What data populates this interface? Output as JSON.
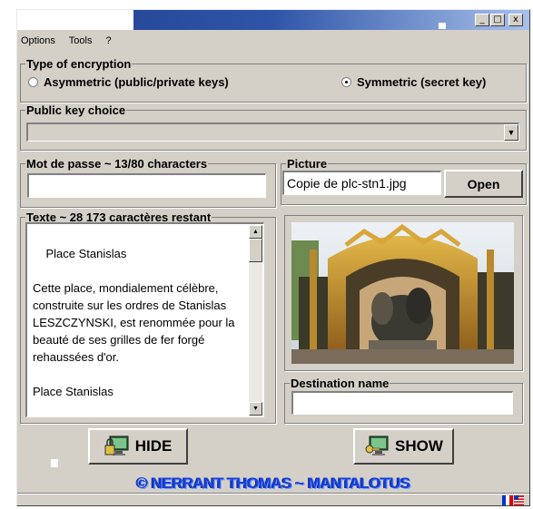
{
  "window": {
    "minimize_glyph": "_",
    "maximize_glyph": "□",
    "close_glyph": "x"
  },
  "menu": [
    "Options",
    "Tools",
    "?"
  ],
  "encryption": {
    "legend": "Type of encryption",
    "asymmetric_label": "Asymmetric (public/private keys)",
    "symmetric_label": "Symmetric (secret key)",
    "selected": "symmetric"
  },
  "public_key": {
    "legend": "Public key choice",
    "value": ""
  },
  "password": {
    "legend": "Mot de passe ~ 13/80 characters",
    "value": ""
  },
  "picture": {
    "legend": "Picture",
    "file": "Copie de plc-stn1.jpg",
    "open_label": "Open"
  },
  "text": {
    "legend": "Texte ~ 28 173 caractères restant",
    "content": "Place Stanislas\n\nCette place, mondialement célèbre, construite sur les ordres de Stanislas LESZCZYNSKI, est renommée pour la beauté de ses grilles de fer forgé rehaussées d'or.\n\nPlace Stanislas"
  },
  "destination": {
    "legend": "Destination name",
    "value": ""
  },
  "actions": {
    "hide_label": "HIDE",
    "show_label": "SHOW"
  },
  "credit": "© NERRANT THOMAS ~ MANTALOTUS",
  "colors": {
    "title_start": "#1f3f8e",
    "credit": "#1a3fd8"
  },
  "icons": {
    "hide_icon": "monitor-lock-icon",
    "show_icon": "monitor-key-icon",
    "language_flags": "flag-icon"
  }
}
